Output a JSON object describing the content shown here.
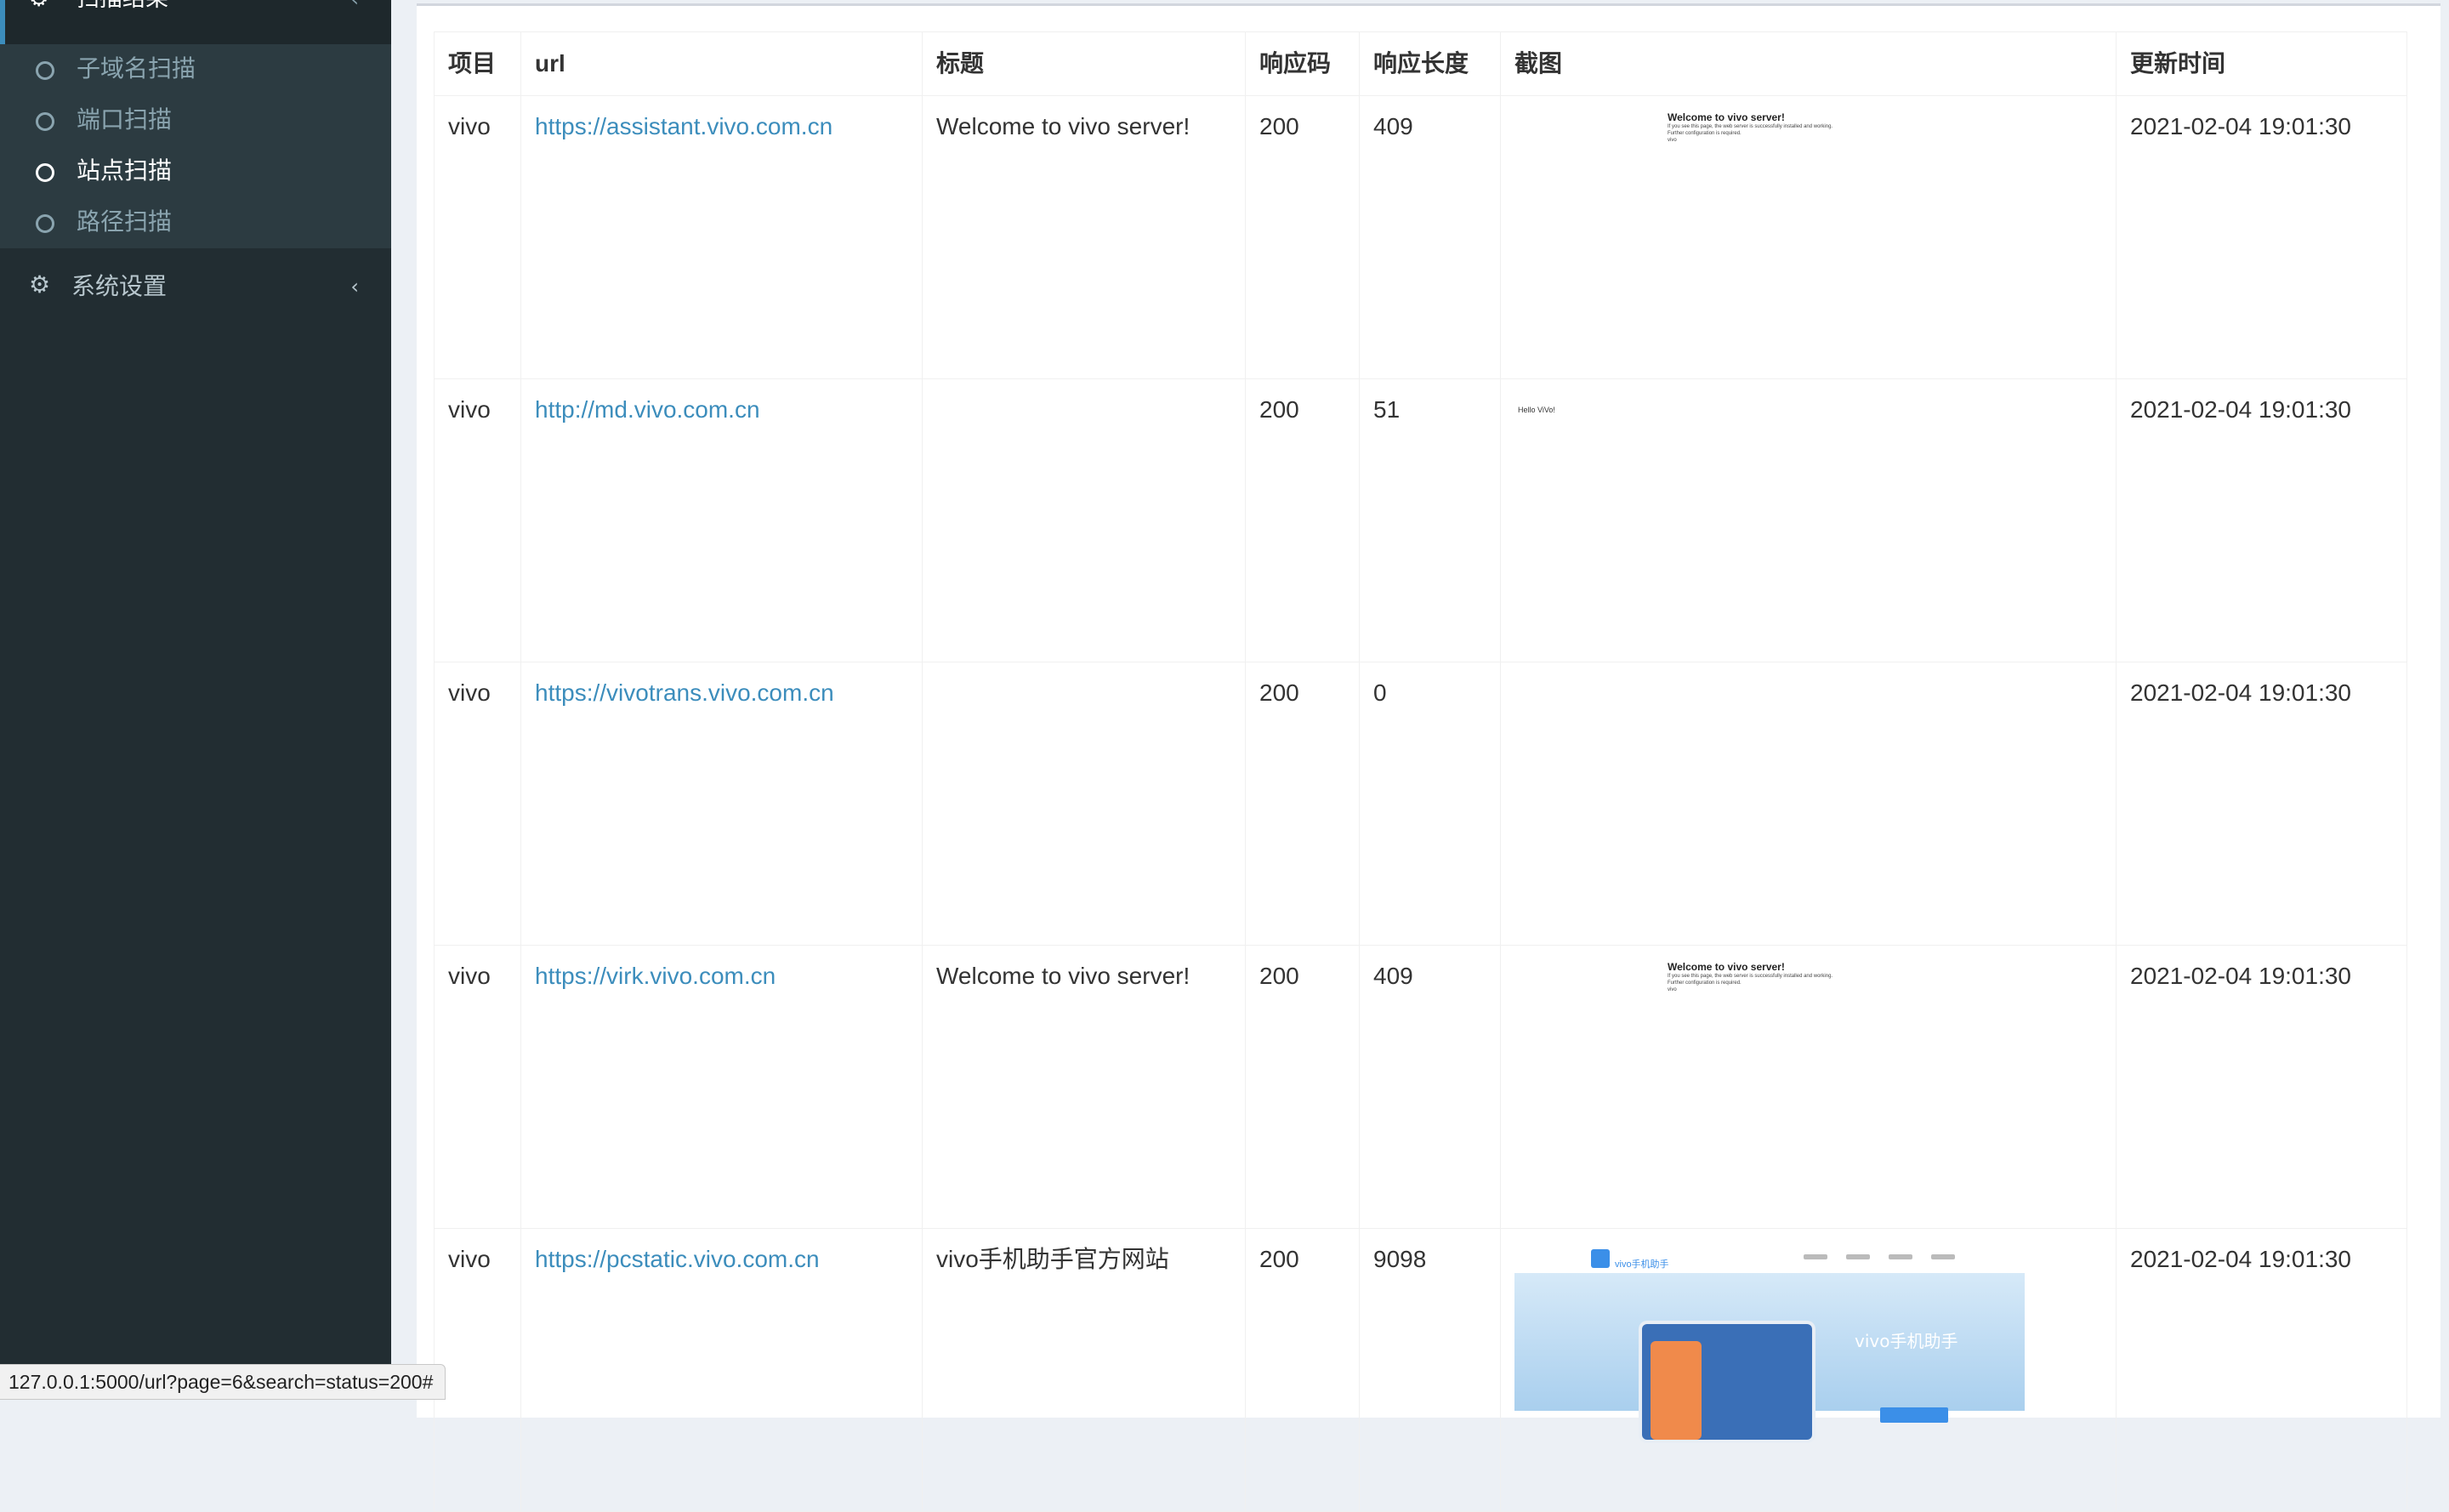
{
  "sidebar": {
    "section_label": "扫描结果",
    "sub_items": [
      {
        "label": "子域名扫描",
        "active": false
      },
      {
        "label": "端口扫描",
        "active": false
      },
      {
        "label": "站点扫描",
        "active": true
      },
      {
        "label": "路径扫描",
        "active": false
      }
    ],
    "settings_label": "系统设置"
  },
  "table": {
    "headers": [
      "项目",
      "url",
      "标题",
      "响应码",
      "响应长度",
      "截图",
      "更新时间"
    ],
    "rows": [
      {
        "project": "vivo",
        "url": "https://assistant.vivo.com.cn",
        "title": "Welcome to vivo server!",
        "code": "200",
        "length": "409",
        "screenshot": "welcome",
        "updated": "2021-02-04 19:01:30"
      },
      {
        "project": "vivo",
        "url": "http://md.vivo.com.cn",
        "title": "",
        "code": "200",
        "length": "51",
        "screenshot": "hello",
        "updated": "2021-02-04 19:01:30"
      },
      {
        "project": "vivo",
        "url": "https://vivotrans.vivo.com.cn",
        "title": "",
        "code": "200",
        "length": "0",
        "screenshot": "none",
        "updated": "2021-02-04 19:01:30"
      },
      {
        "project": "vivo",
        "url": "https://virk.vivo.com.cn",
        "title": "Welcome to vivo server!",
        "code": "200",
        "length": "409",
        "screenshot": "welcome",
        "updated": "2021-02-04 19:01:30"
      },
      {
        "project": "vivo",
        "url": "https://pcstatic.vivo.com.cn",
        "title": "vivo手机助手官方网站",
        "code": "200",
        "length": "9098",
        "screenshot": "site",
        "updated": "2021-02-04 19:01:30"
      }
    ]
  },
  "screenshots": {
    "welcome_title": "Welcome to vivo server!",
    "welcome_line1": "If you see this page, the web server is successfully installed and working.",
    "welcome_line2": "Further configuration is required.",
    "welcome_line3": "vivo",
    "hello_text": "Hello ViVo!",
    "site_logo_text": "vivo手机助手",
    "site_hero_text": "vivo手机助手"
  },
  "status_url": "127.0.0.1:5000/url?page=6&search=status=200#",
  "colors": {
    "sidebar_bg": "#222d32",
    "submenu_bg": "#2c3b41",
    "link": "#3c8dbc",
    "accent": "#3c8dbc"
  }
}
